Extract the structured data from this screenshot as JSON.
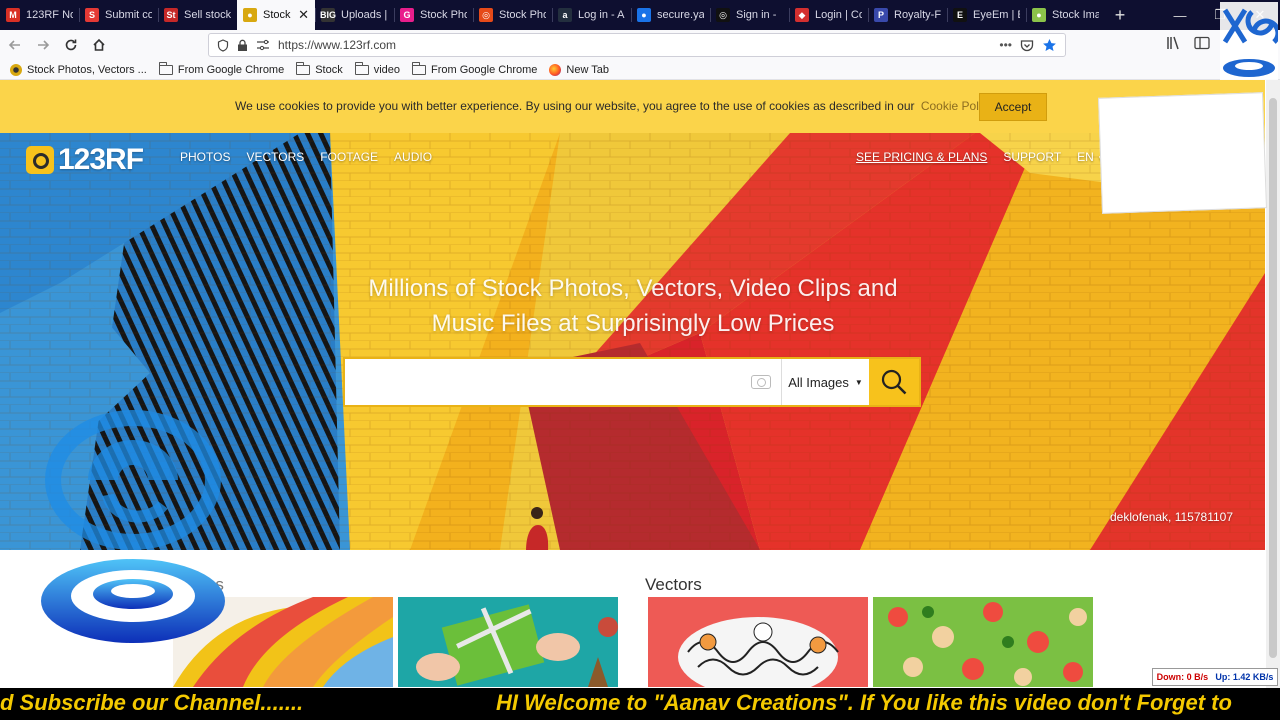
{
  "browser": {
    "tabs": [
      {
        "label": "123RF No",
        "fav_color": "#d93025",
        "fav_glyph": "M"
      },
      {
        "label": "Submit co",
        "fav_color": "#e53935",
        "fav_glyph": "S"
      },
      {
        "label": "Sell stock",
        "fav_color": "#c62828",
        "fav_glyph": "St"
      },
      {
        "label": "Stock",
        "fav_color": "#d8a810",
        "fav_glyph": "●",
        "active": true
      },
      {
        "label": "Uploads |",
        "fav_color": "#333333",
        "fav_glyph": "BIG"
      },
      {
        "label": "Stock Pho",
        "fav_color": "#e91e8c",
        "fav_glyph": "G"
      },
      {
        "label": "Stock Pho",
        "fav_color": "#e64a19",
        "fav_glyph": "◎"
      },
      {
        "label": "Log in - A",
        "fav_color": "#232f3e",
        "fav_glyph": "a"
      },
      {
        "label": "secure.yay",
        "fav_color": "#1a73e8",
        "fav_glyph": "●"
      },
      {
        "label": "Sign in - ",
        "fav_color": "#111111",
        "fav_glyph": "◎"
      },
      {
        "label": "Login | Co",
        "fav_color": "#d32f2f",
        "fav_glyph": "◆"
      },
      {
        "label": "Royalty-F",
        "fav_color": "#3949ab",
        "fav_glyph": "P"
      },
      {
        "label": "EyeEm | E",
        "fav_color": "#111111",
        "fav_glyph": "E"
      },
      {
        "label": "Stock Ima",
        "fav_color": "#8bc34a",
        "fav_glyph": "●"
      }
    ],
    "new_tab_glyph": "+",
    "tab_close_glyph": "✕",
    "window_controls": [
      "—",
      "❐",
      "✕"
    ],
    "url": "https://www.123rf.com",
    "bookmarks": [
      {
        "label": "Stock Photos, Vectors ...",
        "type": "site"
      },
      {
        "label": "From Google Chrome",
        "type": "folder"
      },
      {
        "label": "Stock",
        "type": "folder"
      },
      {
        "label": "video",
        "type": "folder"
      },
      {
        "label": "From Google Chrome",
        "type": "folder"
      },
      {
        "label": "New Tab",
        "type": "firefox"
      }
    ]
  },
  "cookie": {
    "text": "We use cookies to provide you with better experience. By using our website, you agree to the use of cookies as described in our",
    "link": "Cookie Policy",
    "accept": "Accept"
  },
  "site": {
    "logo": "123RF",
    "nav": [
      "PHOTOS",
      "VECTORS",
      "FOOTAGE",
      "AUDIO"
    ],
    "right_nav": {
      "pricing": "SEE PRICING & PLANS",
      "support": "SUPPORT",
      "lang": "EN"
    },
    "headline": "Millions of Stock Photos, Vectors, Video Clips and Music Files at Surprisingly Low Prices",
    "search": {
      "placeholder": "",
      "category": "All Images"
    },
    "credit": "deklofenak, 115781107"
  },
  "content": {
    "photos_title": "Photos",
    "vectors_title": "Vectors"
  },
  "overlay": {
    "speed_down": "Down: 0 B/s",
    "speed_up": "Up: 1.42 KB/s",
    "ticker_left": "d Subscribe our Channel.......",
    "ticker_right": "HI Welcome to \"Aanav Creations\". If You like this video don't Forget to"
  },
  "colors": {
    "accent_yellow": "#f7c21c",
    "cookie_bg": "#fbd44a",
    "tabstrip_bg": "#0e0f30",
    "ticker_text": "#f4c900"
  }
}
